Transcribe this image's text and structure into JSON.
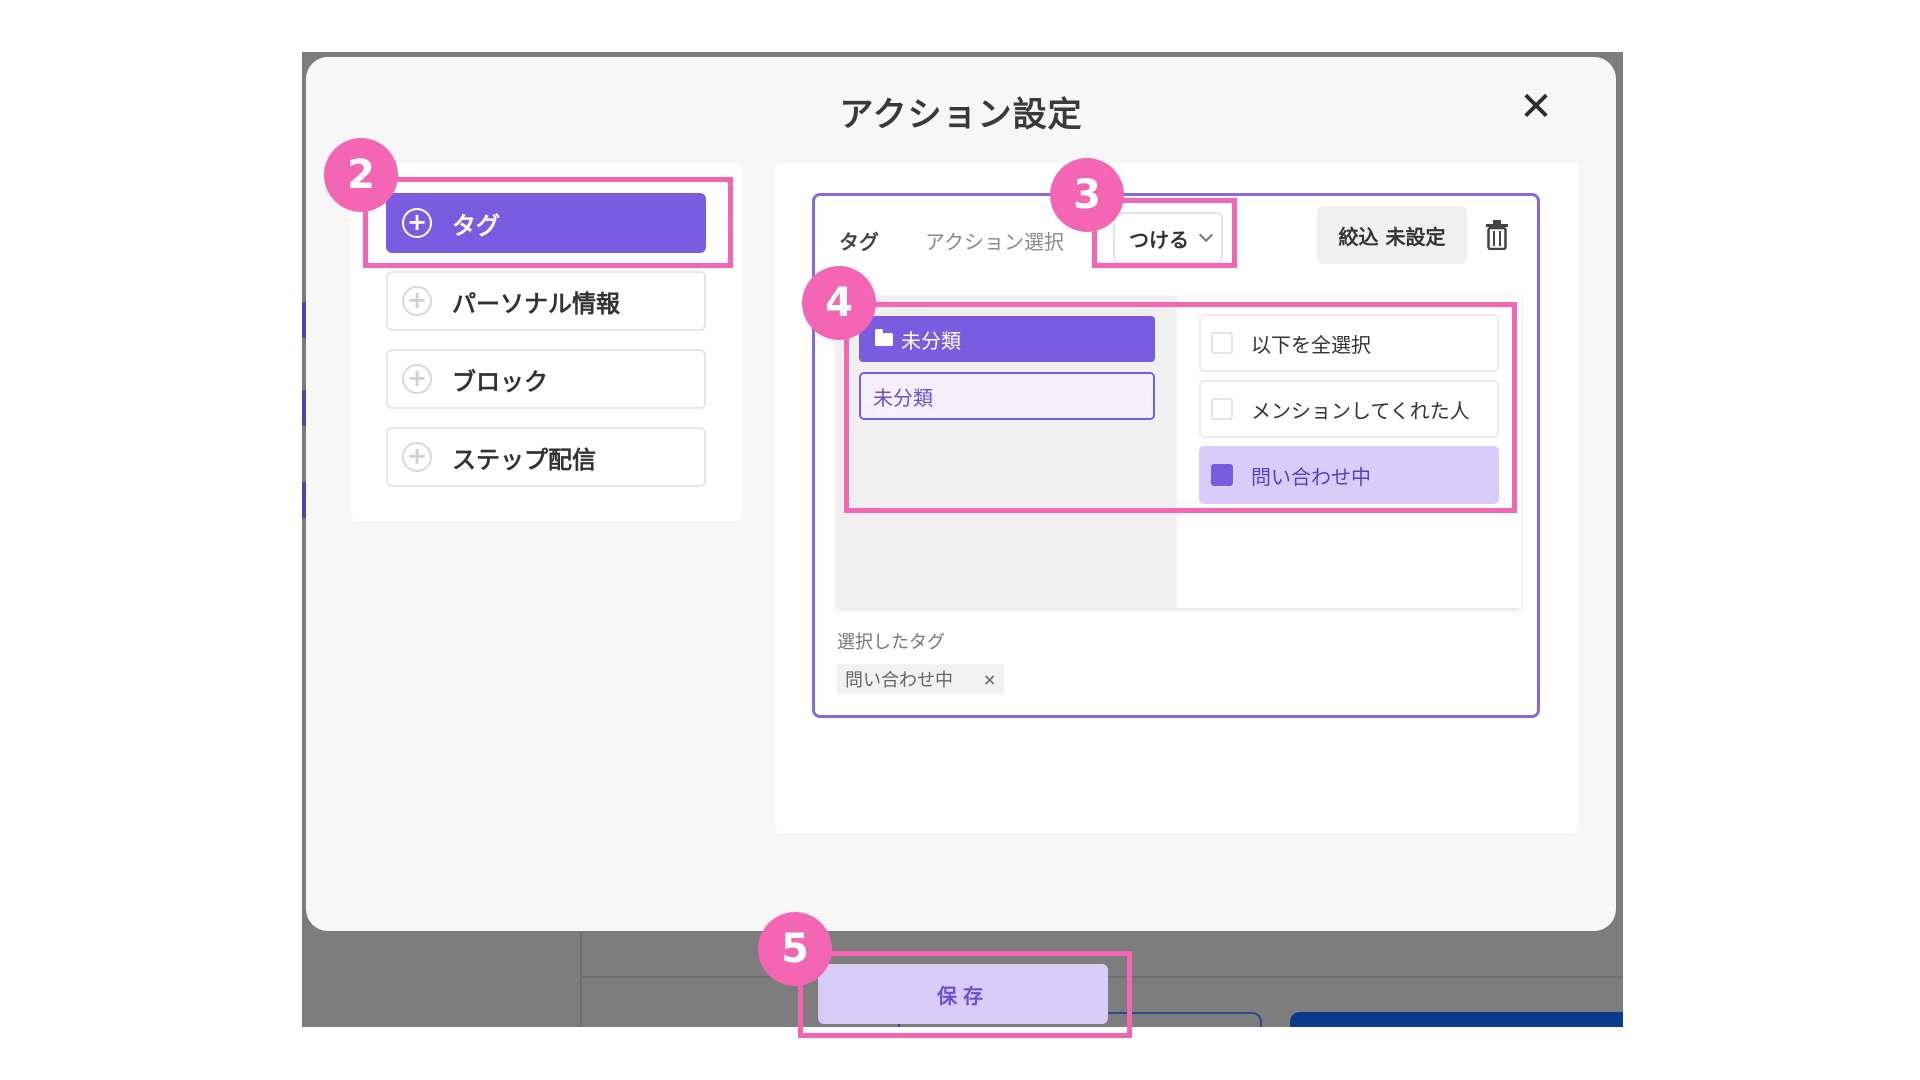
{
  "modal": {
    "title": "アクション設定",
    "close_icon": "close-icon"
  },
  "left_panel": {
    "items": [
      {
        "label": "タグ",
        "icon": "plus-circle-icon",
        "active": true
      },
      {
        "label": "パーソナル情報",
        "icon": "plus-circle-icon",
        "active": false
      },
      {
        "label": "ブロック",
        "icon": "plus-circle-icon",
        "active": false
      },
      {
        "label": "ステップ配信",
        "icon": "plus-circle-icon",
        "active": false
      }
    ]
  },
  "action_card": {
    "type_label": "タグ",
    "action_label": "アクション選択",
    "action_value": "つける",
    "filter_label": "絞込 未設定",
    "trash_icon": "trash-icon",
    "folders": {
      "selected_folder": "未分類",
      "child": "未分類"
    },
    "tag_options": [
      {
        "label": "以下を全選択",
        "checked": false
      },
      {
        "label": "メンションしてくれた人",
        "checked": false
      },
      {
        "label": "問い合わせ中",
        "checked": true
      }
    ],
    "selected_title": "選択したタグ",
    "selected_tags": [
      "問い合わせ中"
    ],
    "chip_close": "×"
  },
  "footer": {
    "save_label": "保存"
  },
  "annotations": {
    "steps": [
      "2",
      "3",
      "4",
      "5"
    ],
    "color": "#f466b4"
  },
  "colors": {
    "accent": "#7a5ce0",
    "accent_light": "#d8ccfa",
    "card_border": "#8a6ad8"
  }
}
